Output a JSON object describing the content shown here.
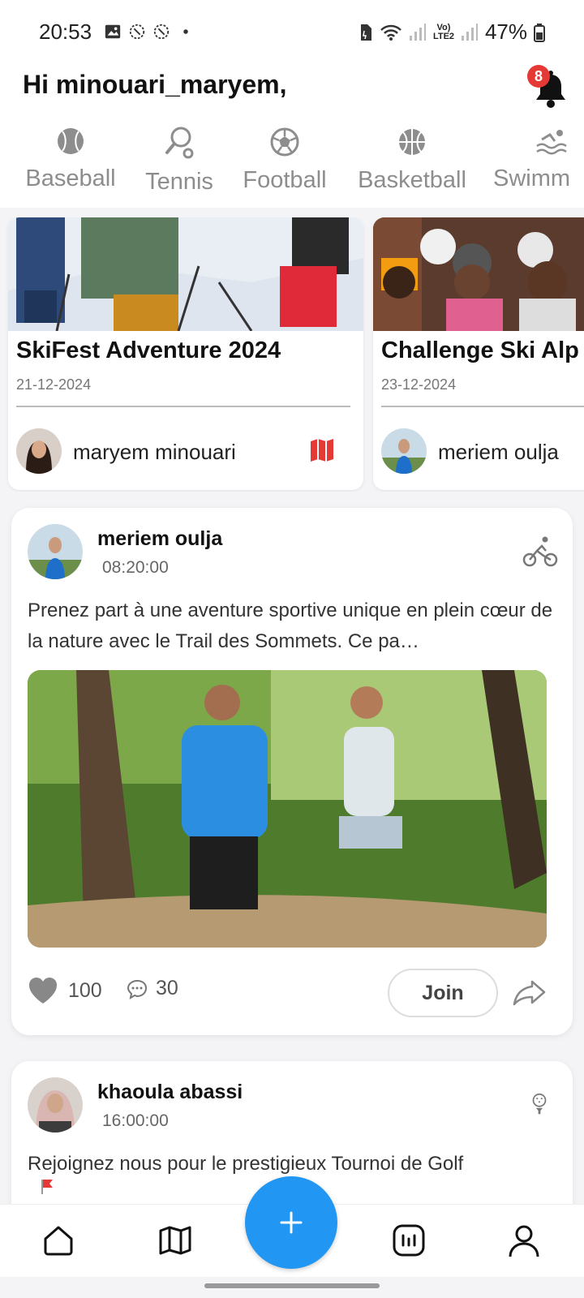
{
  "status_bar": {
    "time": "20:53",
    "battery": "47%",
    "network": "Vo) LTE2"
  },
  "header": {
    "greeting": "Hi minouari_maryem,",
    "notification_count": "8"
  },
  "categories": [
    {
      "label": "Baseball",
      "icon": "baseball-icon"
    },
    {
      "label": "Tennis",
      "icon": "tennis-icon"
    },
    {
      "label": "Football",
      "icon": "football-icon"
    },
    {
      "label": "Basketball",
      "icon": "basketball-icon"
    },
    {
      "label": "Swimm",
      "icon": "swimming-icon"
    }
  ],
  "events": [
    {
      "title": "SkiFest Adventure 2024",
      "date": "21-12-2024",
      "author": "maryem minouari",
      "icon": "map-icon"
    },
    {
      "title": "Challenge Ski Alp",
      "date": "23-12-2024",
      "author": "meriem oulja"
    }
  ],
  "posts": [
    {
      "author": "meriem oulja",
      "time": "08:20:00",
      "text": "Prenez part à une aventure sportive unique en plein cœur de la nature avec le Trail des Sommets. Ce pa…",
      "sport_icon": "cycling-icon",
      "likes": "100",
      "comments": "30",
      "join_label": "Join"
    },
    {
      "author": "khaoula abassi",
      "time": "16:00:00",
      "text": "Rejoignez nous pour le prestigieux Tournoi de Golf",
      "sport_icon": "golf-icon"
    }
  ],
  "bottom_nav": {
    "items": [
      "home-icon",
      "map-icon",
      "add-icon",
      "stats-icon",
      "profile-icon"
    ]
  },
  "colors": {
    "accent": "#2196f3",
    "badge": "#e53935",
    "map_icon": "#e53935"
  }
}
